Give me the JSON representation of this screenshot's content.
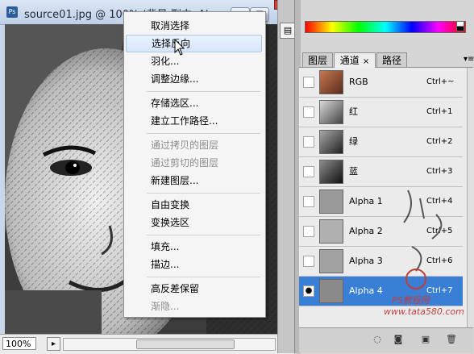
{
  "document": {
    "title": "source01.jpg @ 100% (背景 副本, Alp",
    "app_icon": "Ps",
    "zoom": "100%"
  },
  "context_menu": {
    "items": [
      {
        "label": "取消选择",
        "disabled": false
      },
      {
        "label": "选择反向",
        "disabled": false,
        "highlighted": true
      },
      {
        "label": "羽化...",
        "disabled": false
      },
      {
        "label": "调整边缘...",
        "disabled": false
      },
      {
        "label": "存储选区...",
        "disabled": false
      },
      {
        "label": "建立工作路径...",
        "disabled": false
      },
      {
        "label": "通过拷贝的图层",
        "disabled": true
      },
      {
        "label": "通过剪切的图层",
        "disabled": true
      },
      {
        "label": "新建图层...",
        "disabled": false
      },
      {
        "label": "自由变换",
        "disabled": false
      },
      {
        "label": "变换选区",
        "disabled": false
      },
      {
        "label": "填充...",
        "disabled": false
      },
      {
        "label": "描边...",
        "disabled": false
      },
      {
        "label": "高反差保留",
        "disabled": false
      },
      {
        "label": "渐隐...",
        "disabled": true
      }
    ]
  },
  "panel": {
    "tabs": [
      {
        "label": "图层"
      },
      {
        "label": "通道",
        "active": true,
        "close": "×"
      },
      {
        "label": "路径"
      }
    ],
    "channels": [
      {
        "name": "RGB",
        "shortcut": "Ctrl+~",
        "visible": false
      },
      {
        "name": "红",
        "shortcut": "Ctrl+1",
        "visible": false
      },
      {
        "name": "绿",
        "shortcut": "Ctrl+2",
        "visible": false
      },
      {
        "name": "蓝",
        "shortcut": "Ctrl+3",
        "visible": false
      },
      {
        "name": "Alpha 1",
        "shortcut": "Ctrl+4",
        "visible": false
      },
      {
        "name": "Alpha 2",
        "shortcut": "Ctrl+5",
        "visible": false
      },
      {
        "name": "Alpha 3",
        "shortcut": "Ctrl+6",
        "visible": false
      },
      {
        "name": "Alpha 4",
        "shortcut": "Ctrl+7",
        "visible": true,
        "selected": true
      }
    ],
    "watermark_cn": "PS教程网",
    "watermark_site": "www.tata580.com"
  },
  "colors": {
    "selection": "#3a7fd6",
    "menu_highlight": "#d6e6fb",
    "watermark": "#c03e3e"
  }
}
